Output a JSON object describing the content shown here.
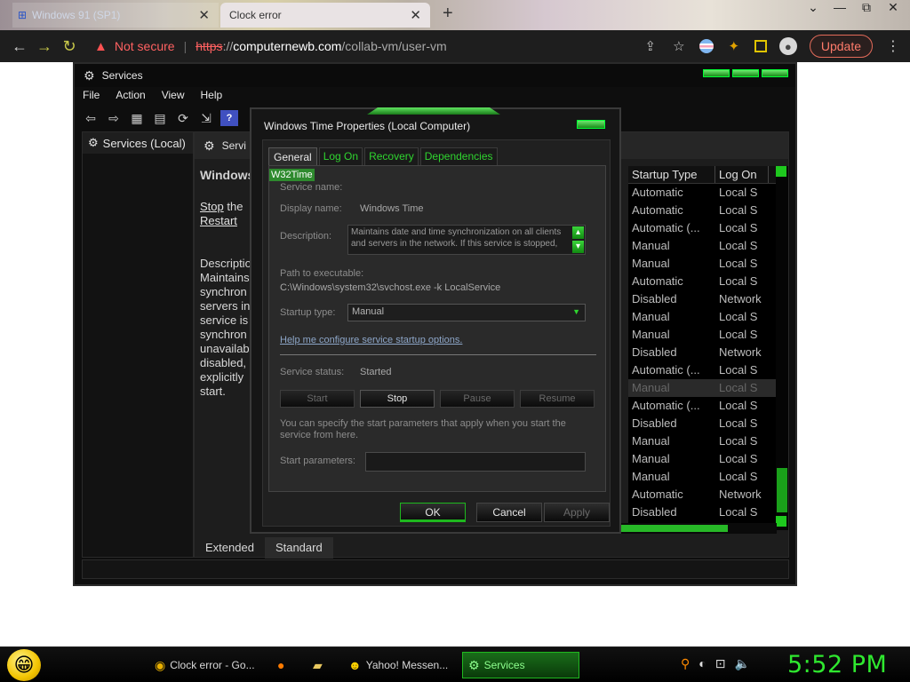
{
  "browser": {
    "tabs": [
      {
        "label": "Windows 91 (SP1)",
        "active": false
      },
      {
        "label": "Clock error",
        "active": true
      }
    ],
    "new_tab": "+",
    "window_controls": [
      "⌄",
      "—",
      "⧉",
      "✕"
    ],
    "url": {
      "security_label": "Not secure",
      "scheme": "https",
      "scheme_sep": "://",
      "host": "computernewb.com",
      "path": "/collab-vm/user-vm"
    },
    "update_label": "Update"
  },
  "mmc": {
    "title": "Services",
    "menu": [
      "File",
      "Action",
      "View",
      "Help"
    ],
    "tree_item": "Services (Local)",
    "header_title": "Servi",
    "ext_title": "Windows",
    "stop_link": "Stop",
    "stop_suffix": " the",
    "restart_link": "Restart",
    "desc_lines": [
      "Descriptio",
      "Maintains",
      "synchron",
      "servers in",
      "service is",
      "synchron",
      "unavailab",
      "disabled,",
      "explicitly",
      "start."
    ],
    "columns": {
      "startup": "Startup Type",
      "logon": "Log On"
    },
    "rows": [
      {
        "startup": "Automatic",
        "logon": "Local S"
      },
      {
        "startup": "Automatic",
        "logon": "Local S"
      },
      {
        "startup": "Automatic (...",
        "logon": "Local S"
      },
      {
        "startup": "Manual",
        "logon": "Local S"
      },
      {
        "startup": "Manual",
        "logon": "Local S"
      },
      {
        "startup": "Automatic",
        "logon": "Local S"
      },
      {
        "startup": "Disabled",
        "logon": "Network"
      },
      {
        "startup": "Manual",
        "logon": "Local S"
      },
      {
        "startup": "Manual",
        "logon": "Local S"
      },
      {
        "startup": "Disabled",
        "logon": "Network"
      },
      {
        "startup": "Automatic (...",
        "logon": "Local S"
      },
      {
        "startup": "Manual",
        "logon": "Local S"
      },
      {
        "startup": "Automatic (...",
        "logon": "Local S"
      },
      {
        "startup": "Disabled",
        "logon": "Local S"
      },
      {
        "startup": "Manual",
        "logon": "Local S"
      },
      {
        "startup": "Manual",
        "logon": "Local S"
      },
      {
        "startup": "Manual",
        "logon": "Local S"
      },
      {
        "startup": "Automatic",
        "logon": "Network"
      },
      {
        "startup": "Disabled",
        "logon": "Local S"
      }
    ],
    "bottom_tabs": [
      "Extended",
      "Standard"
    ]
  },
  "dialog": {
    "title": "Windows Time Properties (Local Computer)",
    "tabs": [
      "General",
      "Log On",
      "Recovery",
      "Dependencies"
    ],
    "service_name_label": "Service name:",
    "service_name": "W32Time",
    "display_name_label": "Display name:",
    "display_name": "Windows Time",
    "description_label": "Description:",
    "description": "Maintains date and time synchronization on all clients and servers in the network. If this service is stopped,",
    "path_label": "Path to executable:",
    "path": "C:\\Windows\\system32\\svchost.exe -k LocalService",
    "startup_label": "Startup type:",
    "startup_value": "Manual",
    "help_link": "Help me configure service startup options.",
    "status_label": "Service status:",
    "status_value": "Started",
    "buttons": {
      "start": "Start",
      "stop": "Stop",
      "pause": "Pause",
      "resume": "Resume"
    },
    "params_hint": "You can specify the start parameters that apply when you start the service from here.",
    "params_label": "Start parameters:",
    "ok": "OK",
    "cancel": "Cancel",
    "apply": "Apply"
  },
  "taskbar": {
    "tasks": [
      {
        "label": "Clock error - Go..."
      },
      {
        "label": "Yahoo! Messen..."
      },
      {
        "label": "Services"
      }
    ],
    "clock": "5:52 PM"
  },
  "colors": {
    "accent": "#2fe82f",
    "window_bg": "#0e0e0e",
    "link_red": "#ff6161"
  }
}
